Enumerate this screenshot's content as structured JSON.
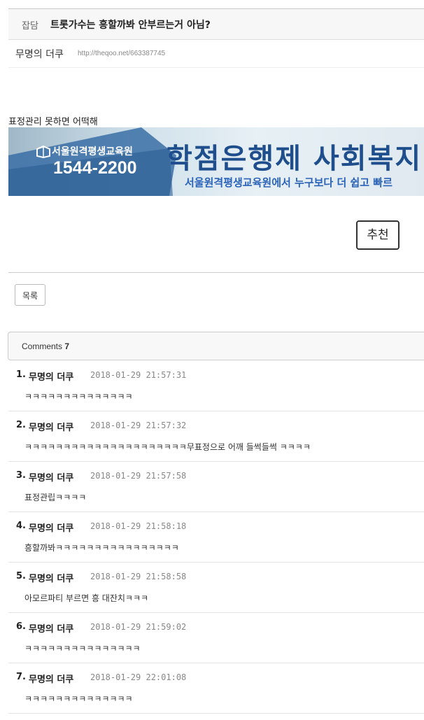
{
  "post": {
    "category": "잡담",
    "title": "트롯가수는 흥할까봐 안부르는거 아님?",
    "author": "무명의 더쿠",
    "url": "http://theqoo.net/663387745",
    "body": "표정관리 못하면 어떡해"
  },
  "banner": {
    "org": "서울원격평생교육원",
    "phone": "1544-2200",
    "headline": "학점은행제  사회복지",
    "sub": "서울원격평생교육원에서 누구보다 더 쉽고 빠르"
  },
  "actions": {
    "recommend": "추천",
    "list": "목록"
  },
  "comments": {
    "label": "Comments",
    "count": "7",
    "items": [
      {
        "num": "1.",
        "author": "무명의 더쿠",
        "date": "2018-01-29 21:57:31",
        "text": "ㅋㅋㅋㅋㅋㅋㅋㅋㅋㅋㅋㅋㅋㅋ"
      },
      {
        "num": "2.",
        "author": "무명의 더쿠",
        "date": "2018-01-29 21:57:32",
        "text": "ㅋㅋㅋㅋㅋㅋㅋㅋㅋㅋㅋㅋㅋㅋㅋㅋㅋㅋㅋㅋㅋ무표정으로 어깨 들썩들썩 ㅋㅋㅋㅋ"
      },
      {
        "num": "3.",
        "author": "무명의 더쿠",
        "date": "2018-01-29 21:57:58",
        "text": "표정관립ㅋㅋㅋㅋ"
      },
      {
        "num": "4.",
        "author": "무명의 더쿠",
        "date": "2018-01-29 21:58:18",
        "text": "흥할까봐ㅋㅋㅋㅋㅋㅋㅋㅋㅋㅋㅋㅋㅋㅋㅋㅋ"
      },
      {
        "num": "5.",
        "author": "무명의 더쿠",
        "date": "2018-01-29 21:58:58",
        "text": "아모르파티 부르면 흥 대잔치ㅋㅋㅋ"
      },
      {
        "num": "6.",
        "author": "무명의 더쿠",
        "date": "2018-01-29 21:59:02",
        "text": "ㅋㅋㅋㅋㅋㅋㅋㅋㅋㅋㅋㅋㅋㅋㅋ"
      },
      {
        "num": "7.",
        "author": "무명의 더쿠",
        "date": "2018-01-29 22:01:08",
        "text": "ㅋㅋㅋㅋㅋㅋㅋㅋㅋㅋㅋㅋㅋㅋ"
      }
    ]
  }
}
